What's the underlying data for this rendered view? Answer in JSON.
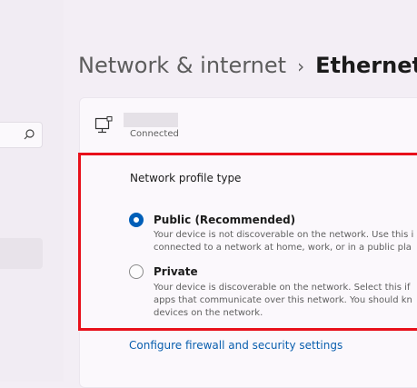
{
  "breadcrumb": {
    "parent": "Network & internet",
    "separator": "›",
    "current": "Ethernet"
  },
  "search": {
    "icon": "search-icon"
  },
  "connection": {
    "status": "Connected",
    "icon": "ethernet-icon"
  },
  "profile": {
    "title": "Network profile type",
    "options": [
      {
        "label": "Public (Recommended)",
        "selected": true,
        "description": [
          "Your device is not discoverable on the network. Use this i",
          "connected to a network at home, work, or in a public pla"
        ]
      },
      {
        "label": "Private",
        "selected": false,
        "description": [
          "Your device is discoverable on the network. Select this if",
          "apps that communicate over this network. You should kn",
          "devices on the network."
        ]
      }
    ]
  },
  "firewall_link": "Configure firewall and security settings",
  "colors": {
    "accent": "#005fb8",
    "highlight": "#e8101b",
    "link": "#0a5fae"
  }
}
